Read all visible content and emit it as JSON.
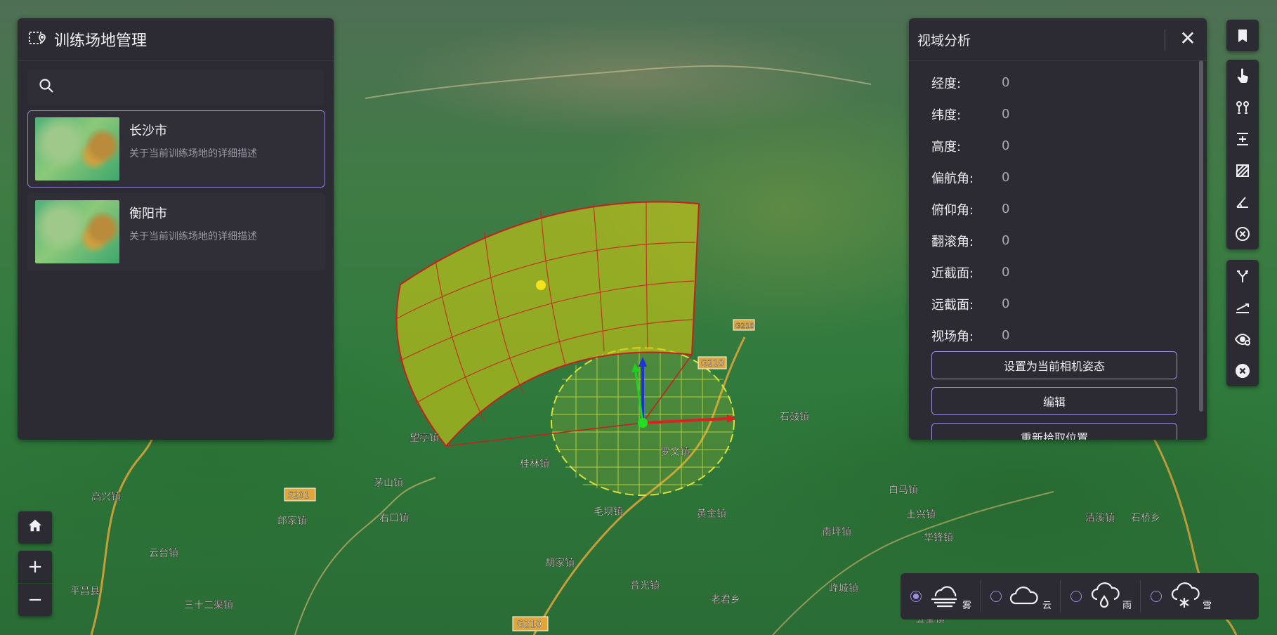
{
  "left_panel": {
    "title": "训练场地管理",
    "search": {
      "value": "",
      "placeholder": ""
    },
    "items": [
      {
        "name": "长沙市",
        "desc": "关于当前训练场地的详细描述",
        "selected": true
      },
      {
        "name": "衡阳市",
        "desc": "关于当前训练场地的详细描述",
        "selected": false
      }
    ]
  },
  "right_panel": {
    "title": "视域分析",
    "rows": [
      {
        "label": "经度:",
        "value": "0"
      },
      {
        "label": "纬度:",
        "value": "0"
      },
      {
        "label": "高度:",
        "value": "0"
      },
      {
        "label": "偏航角:",
        "value": "0"
      },
      {
        "label": "俯仰角:",
        "value": "0"
      },
      {
        "label": "翻滚角:",
        "value": "0"
      },
      {
        "label": "近截面:",
        "value": "0"
      },
      {
        "label": "远截面:",
        "value": "0"
      },
      {
        "label": "视场角:",
        "value": "0"
      }
    ],
    "buttons": [
      "设置为当前相机姿态",
      "编辑",
      "重新拾取位置"
    ]
  },
  "map_labels": [
    "G210",
    "S201",
    "G210",
    "G210",
    "普光镇",
    "老君乡",
    "胡家镇",
    "云台镇",
    "三十二渠镇",
    "毛坝镇",
    "黄金镇",
    "石鼓镇",
    "白马镇",
    "南坪镇",
    "峰城镇",
    "五宝镇",
    "茅山镇",
    "右口镇",
    "郎家镇",
    "罗文镇",
    "桂林镇",
    "高兴镇",
    "望亭镇",
    "平昌县",
    "华锋镇",
    "土兴镇",
    "清溪镇",
    "石桥乡"
  ],
  "toolbar": {
    "group1": [
      "bookmark-icon"
    ],
    "group2": [
      "pointer-icon",
      "path-icon",
      "height-icon",
      "area-icon",
      "angle-icon",
      "clear-icon"
    ],
    "group3": [
      "branch-icon",
      "slope-icon",
      "viewshed-icon",
      "clear-icon"
    ]
  },
  "controls": {
    "home": "⌂",
    "zoom_in": "+",
    "zoom_out": "−"
  },
  "weather": [
    {
      "label": "雾",
      "icon": "fog-icon",
      "selected": true
    },
    {
      "label": "云",
      "icon": "cloud-icon",
      "selected": false
    },
    {
      "label": "雨",
      "icon": "rain-icon",
      "selected": false
    },
    {
      "label": "雪",
      "icon": "snow-icon",
      "selected": false
    }
  ],
  "colors": {
    "accent": "#9b8ee0",
    "panel": "#2c2b33"
  }
}
